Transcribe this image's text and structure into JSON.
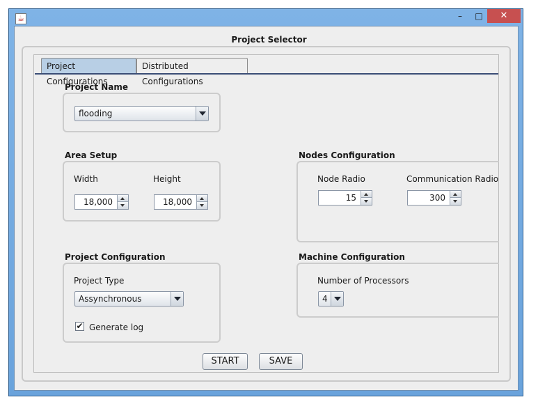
{
  "window": {
    "title": "",
    "minimize_glyph": "–",
    "maximize_glyph": "□",
    "close_glyph": "✕",
    "app_icon": "java-icon",
    "app_icon_glyph": "☕"
  },
  "page_title": "Project Selector",
  "tabs": [
    {
      "label": "Project Configurations",
      "active": true
    },
    {
      "label": "Distributed Configurations",
      "active": false
    }
  ],
  "project_name": {
    "title": "Project Name",
    "selected": "flooding"
  },
  "area_setup": {
    "title": "Area Setup",
    "width_label": "Width",
    "width_value": "18,000",
    "height_label": "Height",
    "height_value": "18,000"
  },
  "nodes_configuration": {
    "title": "Nodes Configuration",
    "node_radio_label": "Node Radio",
    "node_radio_value": "15",
    "comm_radio_label": "Communication Radio",
    "comm_radio_value": "300"
  },
  "project_configuration": {
    "title": "Project Configuration",
    "type_label": "Project Type",
    "type_selected": "Assynchronous",
    "generate_log_label": "Generate log",
    "generate_log_checked": true,
    "check_glyph": "✔"
  },
  "machine_configuration": {
    "title": "Machine Configuration",
    "processors_label": "Number of Processors",
    "processors_selected": "4"
  },
  "actions": {
    "start_label": "START",
    "save_label": "SAVE"
  },
  "colors": {
    "frame": "#6aa3dc",
    "active_tab": "#b8cfe5",
    "close_button": "#c75050",
    "panel_bg": "#eeeeee"
  }
}
